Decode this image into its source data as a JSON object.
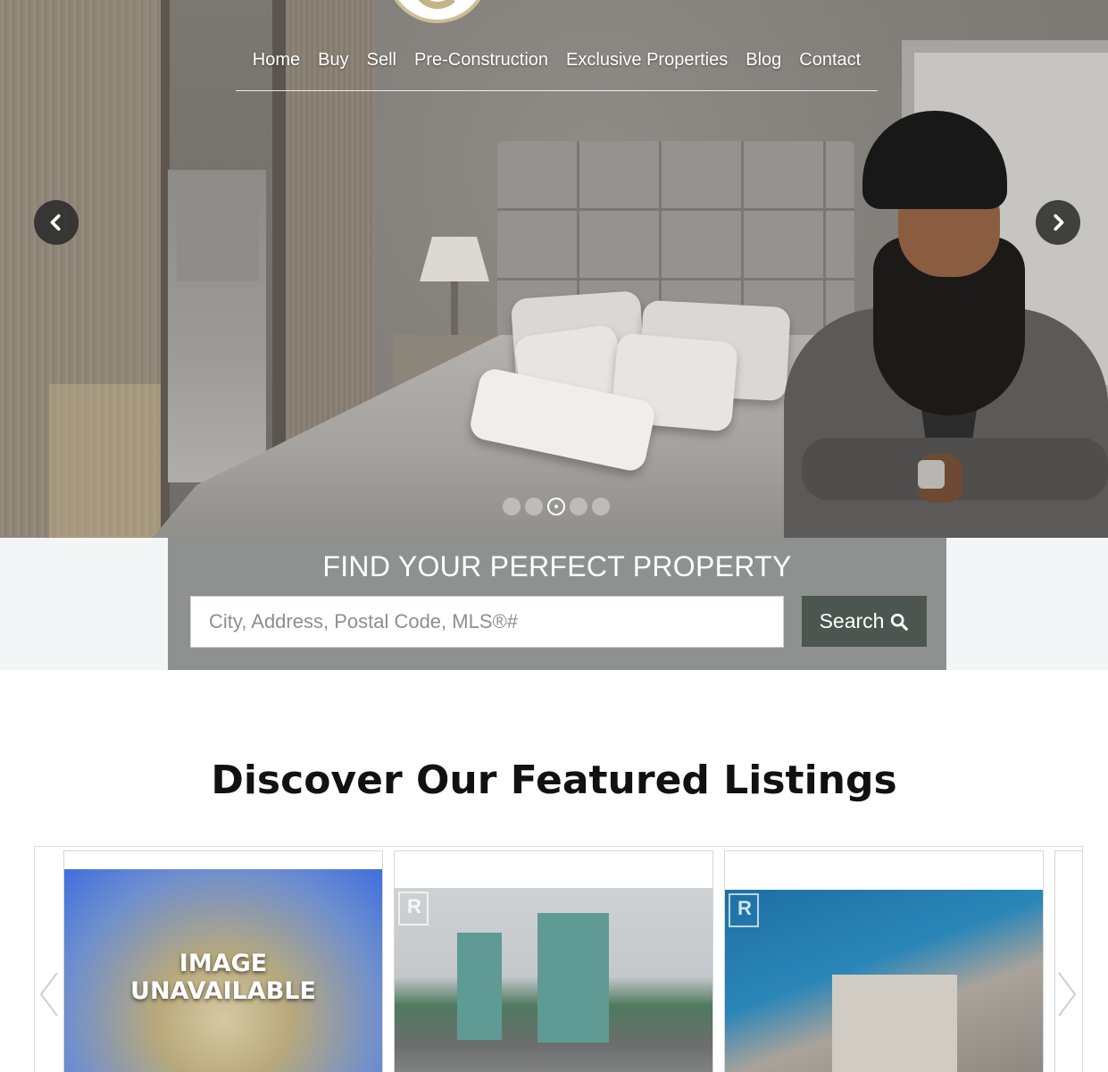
{
  "nav": {
    "items": [
      "Home",
      "Buy",
      "Sell",
      "Pre-Construction",
      "Exclusive Properties",
      "Blog",
      "Contact"
    ]
  },
  "hero": {
    "slides_total": 5,
    "active_slide": 3,
    "icons": {
      "prev": "chevron-left-icon",
      "next": "chevron-right-icon"
    }
  },
  "search": {
    "title": "FIND YOUR PERFECT PROPERTY",
    "placeholder": "City, Address, Postal Code, MLS®#",
    "button_label": "Search",
    "button_icon": "search-icon"
  },
  "featured": {
    "title": "Discover Our Featured Listings",
    "cards": [
      {
        "image_label": "IMAGE UNAVAILABLE"
      },
      {
        "image_label": ""
      },
      {
        "image_label": ""
      }
    ]
  },
  "colors": {
    "search_box_bg": "#8f9190",
    "search_button_bg": "#4c5550",
    "band_bg": "#f4f5f6"
  }
}
